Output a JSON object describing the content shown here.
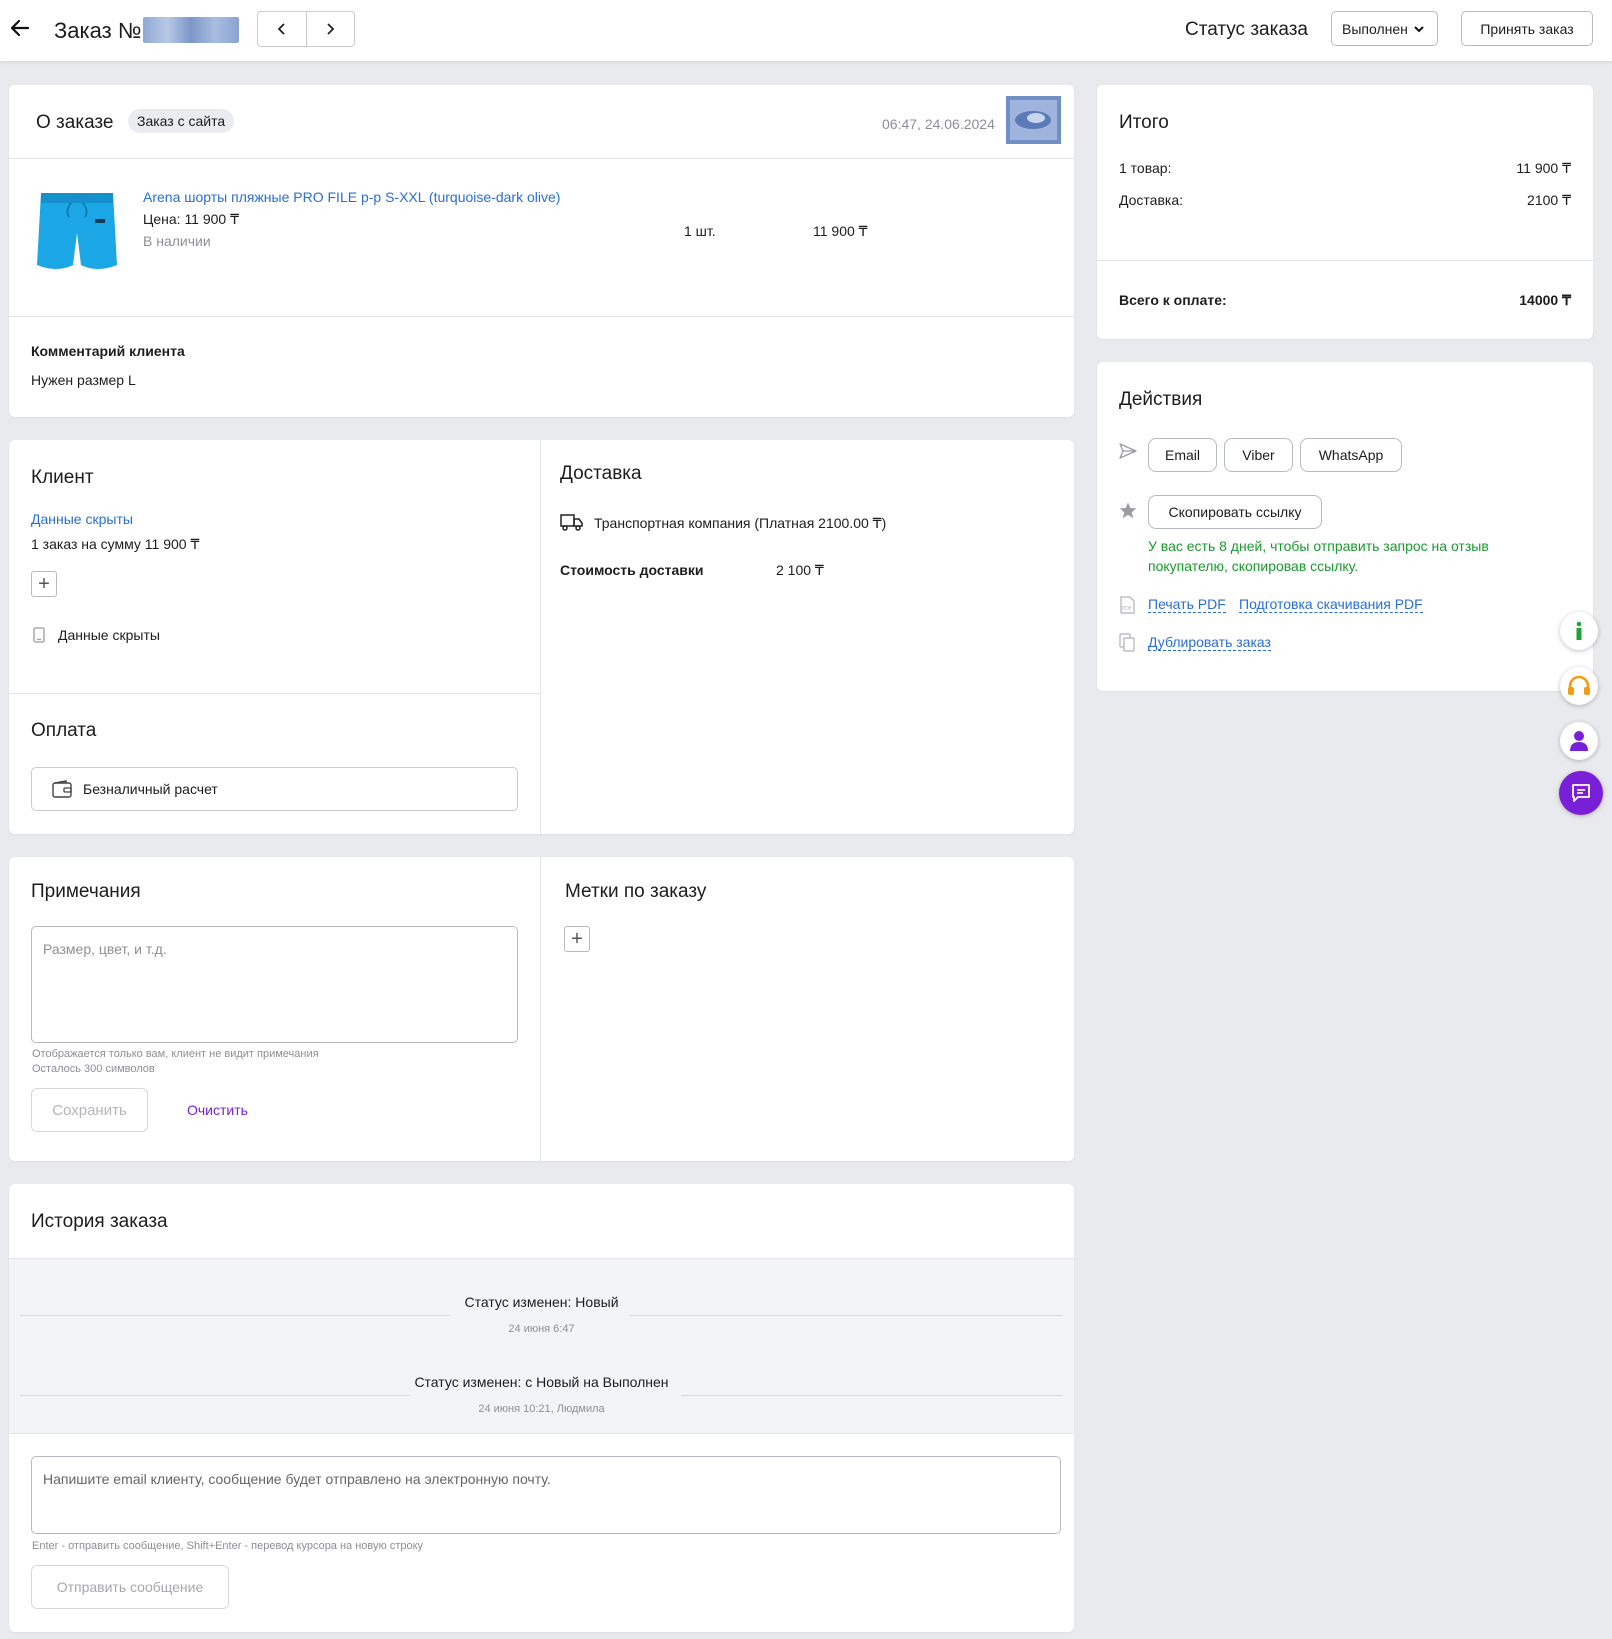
{
  "header": {
    "order_title": "Заказ №",
    "status_label": "Статус заказа",
    "status_value": "Выполнен",
    "accept_label": "Принять заказ"
  },
  "about": {
    "title": "О заказе",
    "badge": "Заказ с сайта",
    "datetime": "06:47, 24.06.2024",
    "product": {
      "name": "Arena шорты пляжные PRO FILE р-р S-XXL (turquoise-dark olive)",
      "price": "Цена: 11 900 ₸",
      "availability": "В наличии",
      "qty": "1 шт.",
      "total": "11 900 ₸"
    },
    "comment_title": "Комментарий клиента",
    "comment_text": "Нужен размер L"
  },
  "client": {
    "title": "Клиент",
    "data_link": "Данные скрыты",
    "orders_summary": "1 заказ на сумму 11 900 ₸",
    "phone": "Данные скрыты"
  },
  "delivery": {
    "title": "Доставка",
    "method": "Транспортная компания (Платная 2100.00 ₸)",
    "cost_label": "Стоимость доставки",
    "cost_value": "2 100 ₸"
  },
  "payment": {
    "title": "Оплата",
    "method": "Безналичный расчет"
  },
  "notes": {
    "title": "Примечания",
    "placeholder": "Размер, цвет, и т.д.",
    "hint1": "Отображается только вам, клиент не видит примечания",
    "hint2": "Осталось 300 символов",
    "save_label": "Сохранить",
    "clear_label": "Очистить"
  },
  "tags": {
    "title": "Метки по заказу"
  },
  "history": {
    "title": "История заказа",
    "events": [
      {
        "text": "Статус изменен: Новый",
        "meta": "24 июня 6:47"
      },
      {
        "text": "Статус изменен: с Новый на Выполнен",
        "meta": "24 июня 10:21, Людмила"
      }
    ],
    "message_placeholder": "Напишите email клиенту, сообщение будет отправлено на электронную почту.",
    "message_hint": "Enter - отправить сообщение, Shift+Enter - перевод курсора на новую строку",
    "send_label": "Отправить сообщение"
  },
  "summary": {
    "title": "Итого",
    "items_label": "1 товар:",
    "items_value": "11 900 ₸",
    "delivery_label": "Доставка:",
    "delivery_value": "2100 ₸",
    "total_label": "Всего к оплате:",
    "total_value": "14000 ₸"
  },
  "actions": {
    "title": "Действия",
    "email": "Email",
    "viber": "Viber",
    "whatsapp": "WhatsApp",
    "copy_link": "Скопировать ссылку",
    "review_note": "У вас есть 8 дней, чтобы отправить запрос на отзыв покупателю, скопировав ссылку.",
    "print_pdf": "Печать PDF",
    "prepare_pdf": "Подготовка скачивания PDF",
    "duplicate": "Дублировать заказ"
  },
  "colors": {
    "link": "#2a6fd4",
    "success": "#1a9a2e",
    "accent_purple": "#7a1fd8",
    "info_green": "#1ea53a",
    "support_orange": "#f39c12"
  }
}
